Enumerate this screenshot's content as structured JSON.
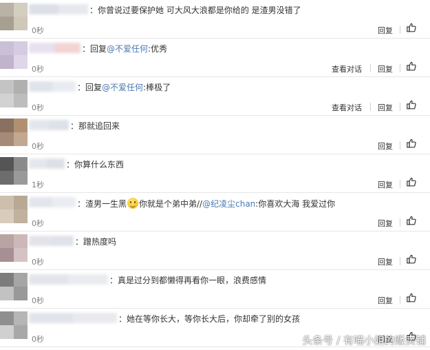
{
  "labels": {
    "reply": "回复",
    "view_conversation": "查看对话"
  },
  "comments": [
    {
      "text": "：你曾说过要保护她 可大风大浪都是你给的 是渣男没错了",
      "time": "0秒",
      "has_view_conversation": false
    },
    {
      "prefix": "：回复",
      "mention": "@不爱任何",
      "suffix": ":优秀",
      "time": "0秒",
      "has_view_conversation": true
    },
    {
      "prefix": "：回复",
      "mention": "@不爱任何",
      "suffix": ":棒极了",
      "time": "0秒",
      "has_view_conversation": true
    },
    {
      "text": "：那就追回来",
      "time": "0秒",
      "has_view_conversation": false
    },
    {
      "text": "：你算什么东西",
      "time": "1秒",
      "has_view_conversation": false
    },
    {
      "prefix": "：渣男一生黑",
      "middle": "你就是个弟中弟//",
      "mention": "@纪凌尘chan",
      "suffix": ":你喜欢大海 我爱过你",
      "time": "0秒",
      "has_view_conversation": false
    },
    {
      "text": "：蹭热度吗",
      "time": "0秒",
      "has_view_conversation": false
    },
    {
      "text": "：真是过分到都懒得再看你一眼，浪费感情",
      "time": "0秒",
      "has_view_conversation": false
    },
    {
      "text": "：她在等你长大，等你长大后，你却牵了别的女孩",
      "time": "0秒",
      "has_view_conversation": false
    }
  ],
  "watermark": "头条号 / 有喵小姐的贩卖铺",
  "colors": {
    "mention": "#4a78b3",
    "time": "#808080",
    "divider": "#e6e6e6"
  },
  "icons": {
    "like": "thumbs-up-icon",
    "emoji": "smiley-emoji-icon"
  }
}
